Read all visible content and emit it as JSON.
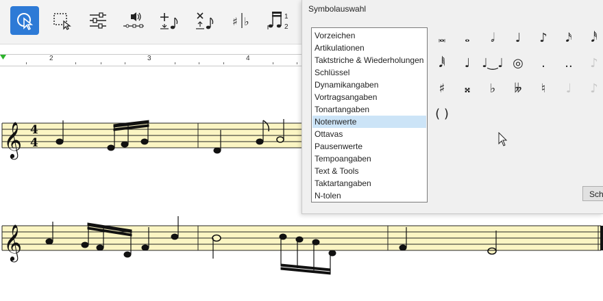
{
  "toolbar": {
    "tools": [
      {
        "name": "select-cursor-tool",
        "active": true
      },
      {
        "name": "marquee-select-tool",
        "active": false
      },
      {
        "name": "properties-sliders-tool",
        "active": false
      },
      {
        "name": "audio-playback-tool",
        "active": false
      },
      {
        "name": "insert-note-tool",
        "active": false
      },
      {
        "name": "delete-note-tool",
        "active": false
      },
      {
        "name": "accidentals-tool",
        "active": false
      },
      {
        "name": "tuplet-tool",
        "active": false
      }
    ]
  },
  "ruler": {
    "labels": [
      "2",
      "3",
      "4"
    ]
  },
  "dialog": {
    "title": "Symbolauswahl",
    "categories": [
      "Vorzeichen",
      "Artikulationen",
      "Taktstriche & Wiederholungen",
      "Schlüssel",
      "Dynamikangaben",
      "Vortragsangaben",
      "Tonartangaben",
      "Notenwerte",
      "Ottavas",
      "Pausenwerte",
      "Tempoangaben",
      "Text & Tools",
      "Taktartangaben",
      "N-tolen"
    ],
    "selected_category": "Notenwerte",
    "symbols": [
      {
        "name": "breve-note-icon",
        "glyph": "𝅜"
      },
      {
        "name": "whole-note-icon",
        "glyph": "𝅝"
      },
      {
        "name": "half-note-icon",
        "glyph": "𝅗𝅥"
      },
      {
        "name": "quarter-note-icon",
        "glyph": "♩"
      },
      {
        "name": "eighth-note-icon",
        "glyph": "♪"
      },
      {
        "name": "sixteenth-note-icon",
        "glyph": "𝅘𝅥𝅯"
      },
      {
        "name": "thirty-second-note-icon",
        "glyph": "𝅘𝅥𝅰"
      },
      {
        "name": "sixty-fourth-note-icon",
        "glyph": "𝅘𝅥𝅱"
      },
      {
        "name": "chord-icon",
        "glyph": "♩"
      },
      {
        "name": "tied-notes-icon",
        "glyph": "♩‿♩"
      },
      {
        "name": "chord-tie-icon",
        "glyph": "◎"
      },
      {
        "name": "augmentation-dot-icon",
        "glyph": "."
      },
      {
        "name": "double-dot-icon",
        "glyph": ".."
      },
      {
        "name": "grace-note-icon",
        "glyph": "♪",
        "dim": true
      },
      {
        "name": "sharp-icon",
        "glyph": "♯"
      },
      {
        "name": "double-sharp-icon",
        "glyph": "𝄪"
      },
      {
        "name": "flat-icon",
        "glyph": "♭"
      },
      {
        "name": "double-flat-icon",
        "glyph": "𝄫"
      },
      {
        "name": "natural-icon",
        "glyph": "♮"
      },
      {
        "name": "disabled-note-icon",
        "glyph": "♩",
        "dim": true
      },
      {
        "name": "disabled-note-icon-2",
        "glyph": "♪",
        "dim": true
      },
      {
        "name": "parentheses-icon",
        "glyph": "( )"
      }
    ],
    "close_label": "Schließen"
  }
}
